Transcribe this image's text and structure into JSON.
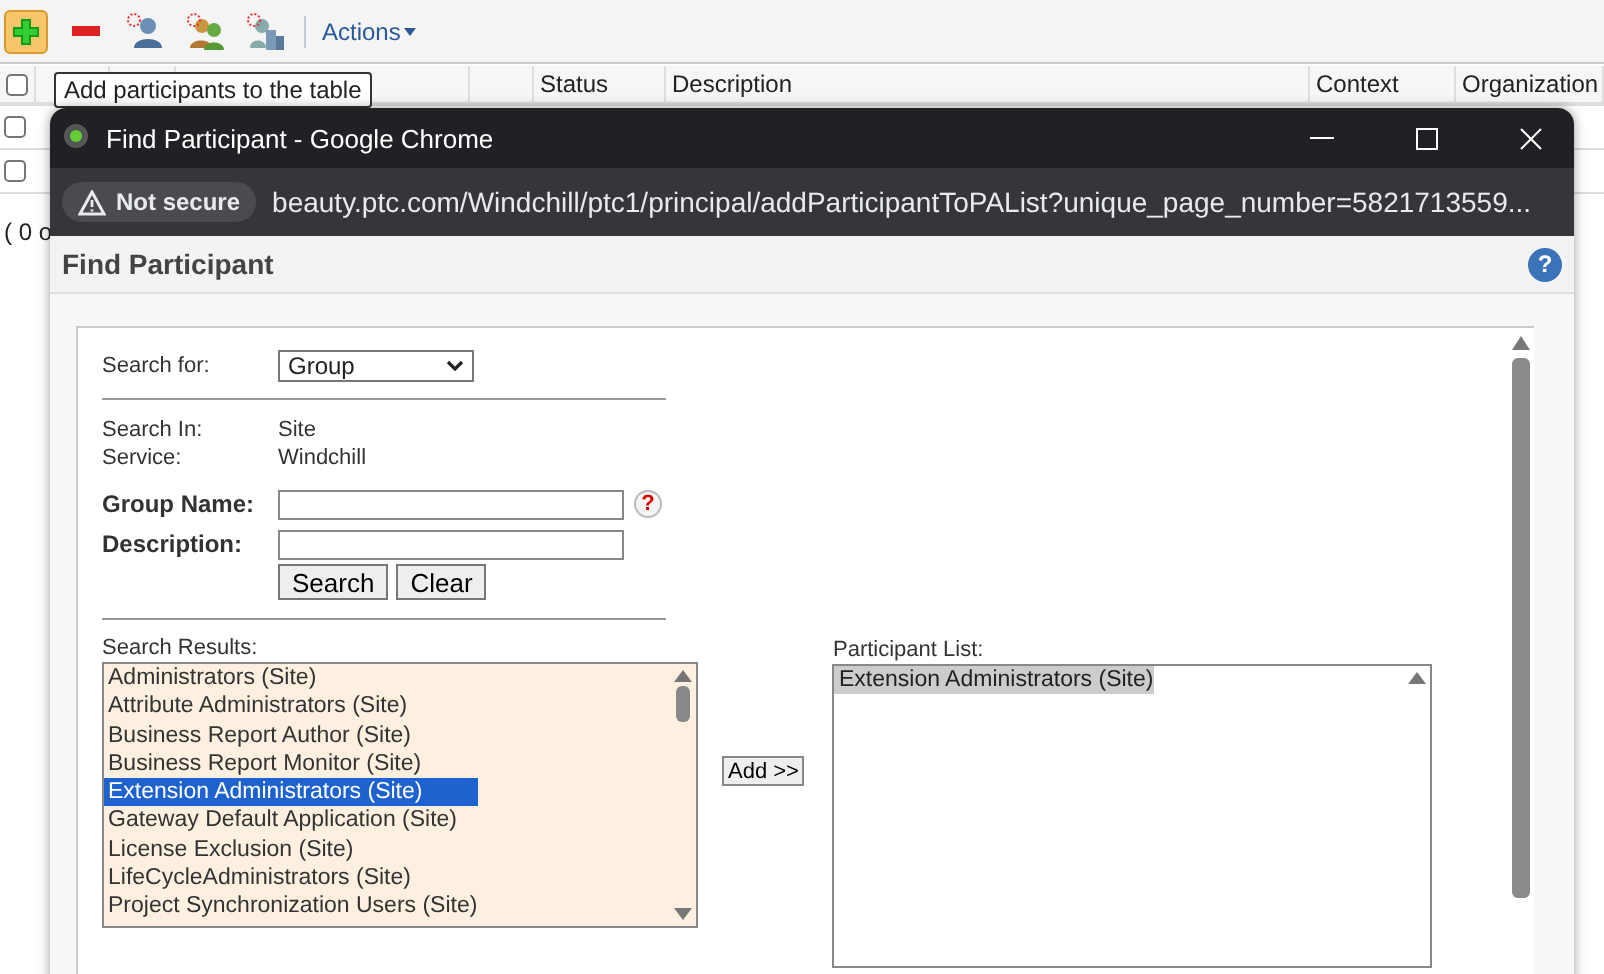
{
  "toolbar": {
    "tooltip": "Add participants to the table",
    "actions_label": "Actions"
  },
  "table": {
    "header_checkbox": {
      "checked": false
    },
    "columns": [
      {
        "label": "Status"
      },
      {
        "label": "Description"
      },
      {
        "label": "Context"
      },
      {
        "label": "Organization"
      }
    ],
    "rows": [
      {
        "checked": false
      },
      {
        "checked": false
      }
    ],
    "footer_text": "( 0 o"
  },
  "popup": {
    "title": "Find Participant - Google Chrome",
    "security": "Not secure",
    "url": "beauty.ptc.com/Windchill/ptc1/principal/addParticipantToPAList?unique_page_number=5821713559...",
    "page_title": "Find Participant",
    "help_glyph": "?",
    "search_for": {
      "label": "Search for:",
      "value": "Group"
    },
    "info": [
      {
        "label": "Search In:",
        "value": "Site"
      },
      {
        "label": "Service:",
        "value": "Windchill"
      }
    ],
    "fields": [
      {
        "label": "Group Name:",
        "help": "?"
      },
      {
        "label": "Description:"
      }
    ],
    "buttons": [
      "Search",
      "Clear"
    ],
    "results": {
      "label": "Search Results:",
      "items": [
        {
          "label": "Administrators (Site)",
          "selected": false
        },
        {
          "label": "Attribute Administrators (Site)",
          "selected": false
        },
        {
          "label": "Business Report Author (Site)",
          "selected": false
        },
        {
          "label": "Business Report Monitor (Site)",
          "selected": false
        },
        {
          "label": "Extension Administrators (Site)",
          "selected": true
        },
        {
          "label": "Gateway Default Application (Site)",
          "selected": false
        },
        {
          "label": "License Exclusion (Site)",
          "selected": false
        },
        {
          "label": "LifeCycleAdministrators (Site)",
          "selected": false
        },
        {
          "label": "Project Synchronization Users (Site)",
          "selected": false
        }
      ]
    },
    "add_button": "Add >>",
    "participants": {
      "label": "Participant List:",
      "items": [
        {
          "label": "Extension Administrators (Site)",
          "selected": true
        }
      ]
    }
  }
}
